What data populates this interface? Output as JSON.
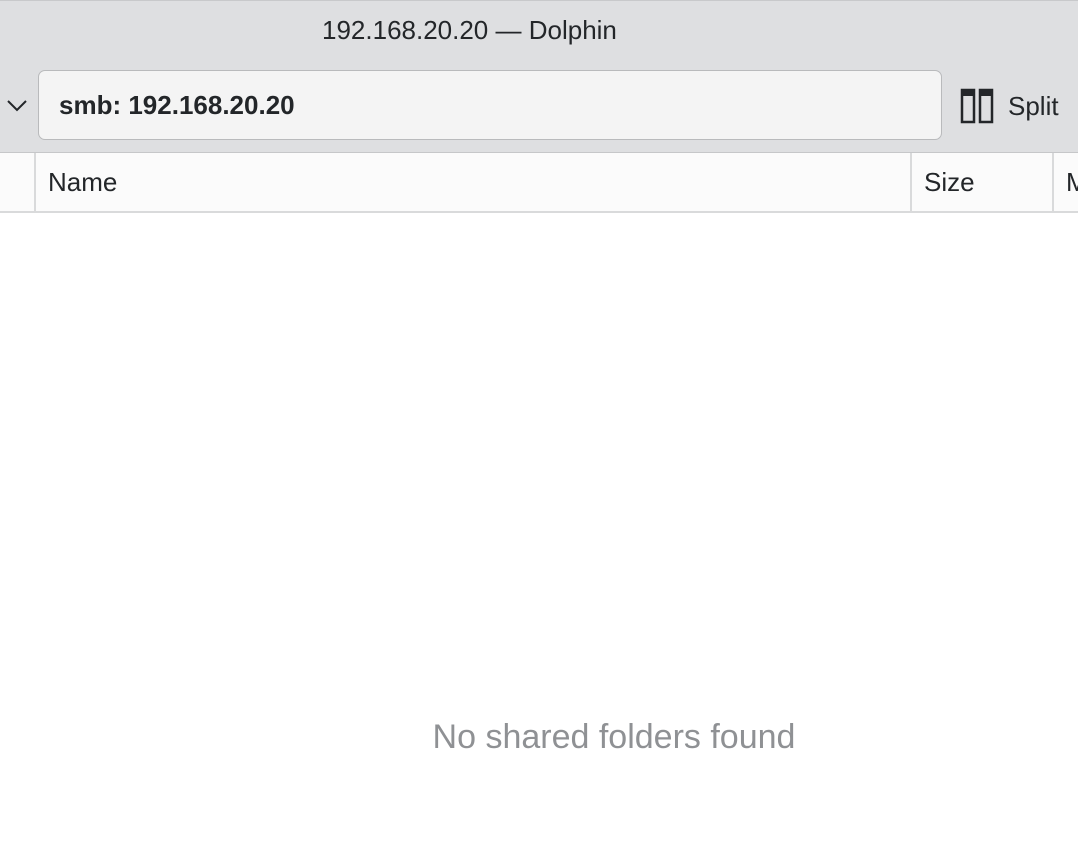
{
  "window": {
    "title": "192.168.20.20 — Dolphin"
  },
  "toolbar": {
    "location_value": "smb: 192.168.20.20",
    "dropdown_icon": "chevron-down-icon",
    "split_icon": "split-view-icon",
    "split_label": "Split"
  },
  "columns": {
    "name": "Name",
    "size": "Size",
    "modified": "Modified"
  },
  "content": {
    "empty_message": "No shared folders found"
  },
  "colors": {
    "chrome": "#dedfe1",
    "text": "#232629",
    "muted_text": "#8f9194"
  }
}
